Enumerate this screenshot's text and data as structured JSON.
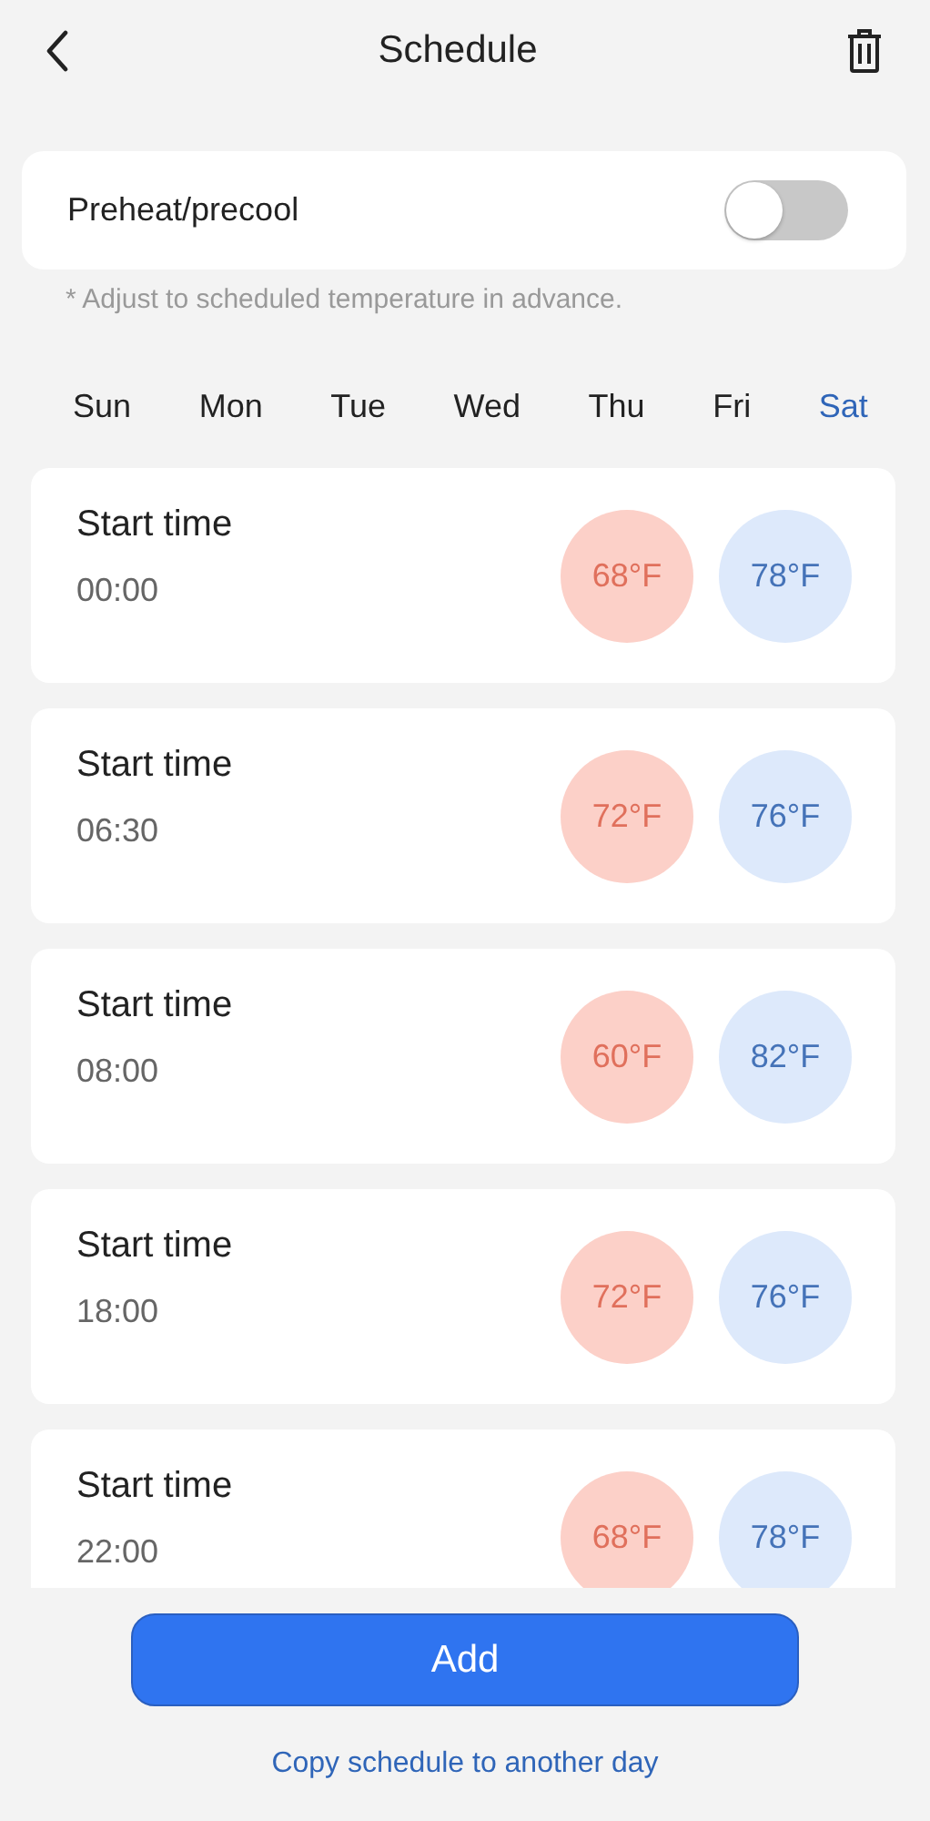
{
  "header": {
    "title": "Schedule"
  },
  "preheat": {
    "label": "Preheat/precool",
    "on": false,
    "note": "* Adjust to scheduled temperature in advance."
  },
  "days": [
    {
      "label": "Sun",
      "selected": false
    },
    {
      "label": "Mon",
      "selected": false
    },
    {
      "label": "Tue",
      "selected": false
    },
    {
      "label": "Wed",
      "selected": false
    },
    {
      "label": "Thu",
      "selected": false
    },
    {
      "label": "Fri",
      "selected": false
    },
    {
      "label": "Sat",
      "selected": true
    }
  ],
  "entries": [
    {
      "label": "Start time",
      "time": "00:00",
      "heat": "68°F",
      "cool": "78°F"
    },
    {
      "label": "Start time",
      "time": "06:30",
      "heat": "72°F",
      "cool": "76°F"
    },
    {
      "label": "Start time",
      "time": "08:00",
      "heat": "60°F",
      "cool": "82°F"
    },
    {
      "label": "Start time",
      "time": "18:00",
      "heat": "72°F",
      "cool": "76°F"
    },
    {
      "label": "Start time",
      "time": "22:00",
      "heat": "68°F",
      "cool": "78°F"
    }
  ],
  "add_button": "Add",
  "copy_link": "Copy schedule to another day"
}
